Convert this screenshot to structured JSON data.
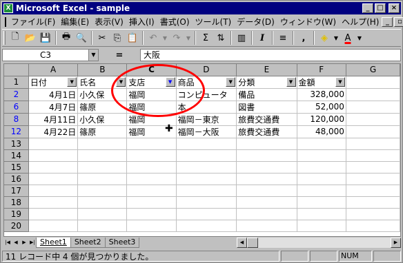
{
  "window": {
    "title": "Microsoft Excel - sample"
  },
  "menu": [
    "ファイル(F)",
    "編集(E)",
    "表示(V)",
    "挿入(I)",
    "書式(O)",
    "ツール(T)",
    "データ(D)",
    "ウィンドウ(W)",
    "ヘルプ(H)"
  ],
  "toolbar": {
    "icons": [
      "new-icon",
      "open-icon",
      "save-icon",
      "print-icon",
      "preview-icon",
      "cut-icon",
      "copy-icon",
      "paste-icon",
      "undo-icon",
      "redo-icon",
      "autosum-icon",
      "sort-icon",
      "chart-icon",
      "italic-icon",
      "align-center-icon",
      "comma-icon",
      "fill-color-icon",
      "font-color-icon"
    ],
    "autosum_label": "Σ",
    "italic_label": "I",
    "comma_label": ",",
    "font_color_label": "A"
  },
  "formula_bar": {
    "name_box": "C3",
    "equals": "=",
    "content": "大阪"
  },
  "columns": [
    "A",
    "B",
    "C",
    "D",
    "E",
    "F",
    "G"
  ],
  "header_row": {
    "row_number": "1",
    "cells": [
      "日付",
      "氏名",
      "支店",
      "商品",
      "分類",
      "金額",
      ""
    ]
  },
  "rows": [
    {
      "row_number": "2",
      "cells": [
        "4月1日",
        "小久保",
        "福岡",
        "コンピュータ",
        "備品",
        "328,000",
        ""
      ]
    },
    {
      "row_number": "6",
      "cells": [
        "4月7日",
        "篠原",
        "福岡",
        "本",
        "図書",
        "52,000",
        ""
      ]
    },
    {
      "row_number": "8",
      "cells": [
        "4月11日",
        "小久保",
        "福岡",
        "福岡－東京",
        "旅費交通費",
        "120,000",
        ""
      ]
    },
    {
      "row_number": "12",
      "cells": [
        "4月22日",
        "篠原",
        "福岡",
        "福岡－大阪",
        "旅費交通費",
        "48,000",
        ""
      ]
    }
  ],
  "empty_rows": [
    "13",
    "14",
    "15",
    "16",
    "17",
    "18",
    "19",
    "20"
  ],
  "sheets": [
    "Sheet1",
    "Sheet2",
    "Sheet3"
  ],
  "status": {
    "message": "11 レコード中 4 個が見つかりました。",
    "num": "NUM"
  },
  "colors": {
    "title_bar": "#000080",
    "filtered_row_number": "#0000ff",
    "annotation_circle": "#ff0000"
  }
}
